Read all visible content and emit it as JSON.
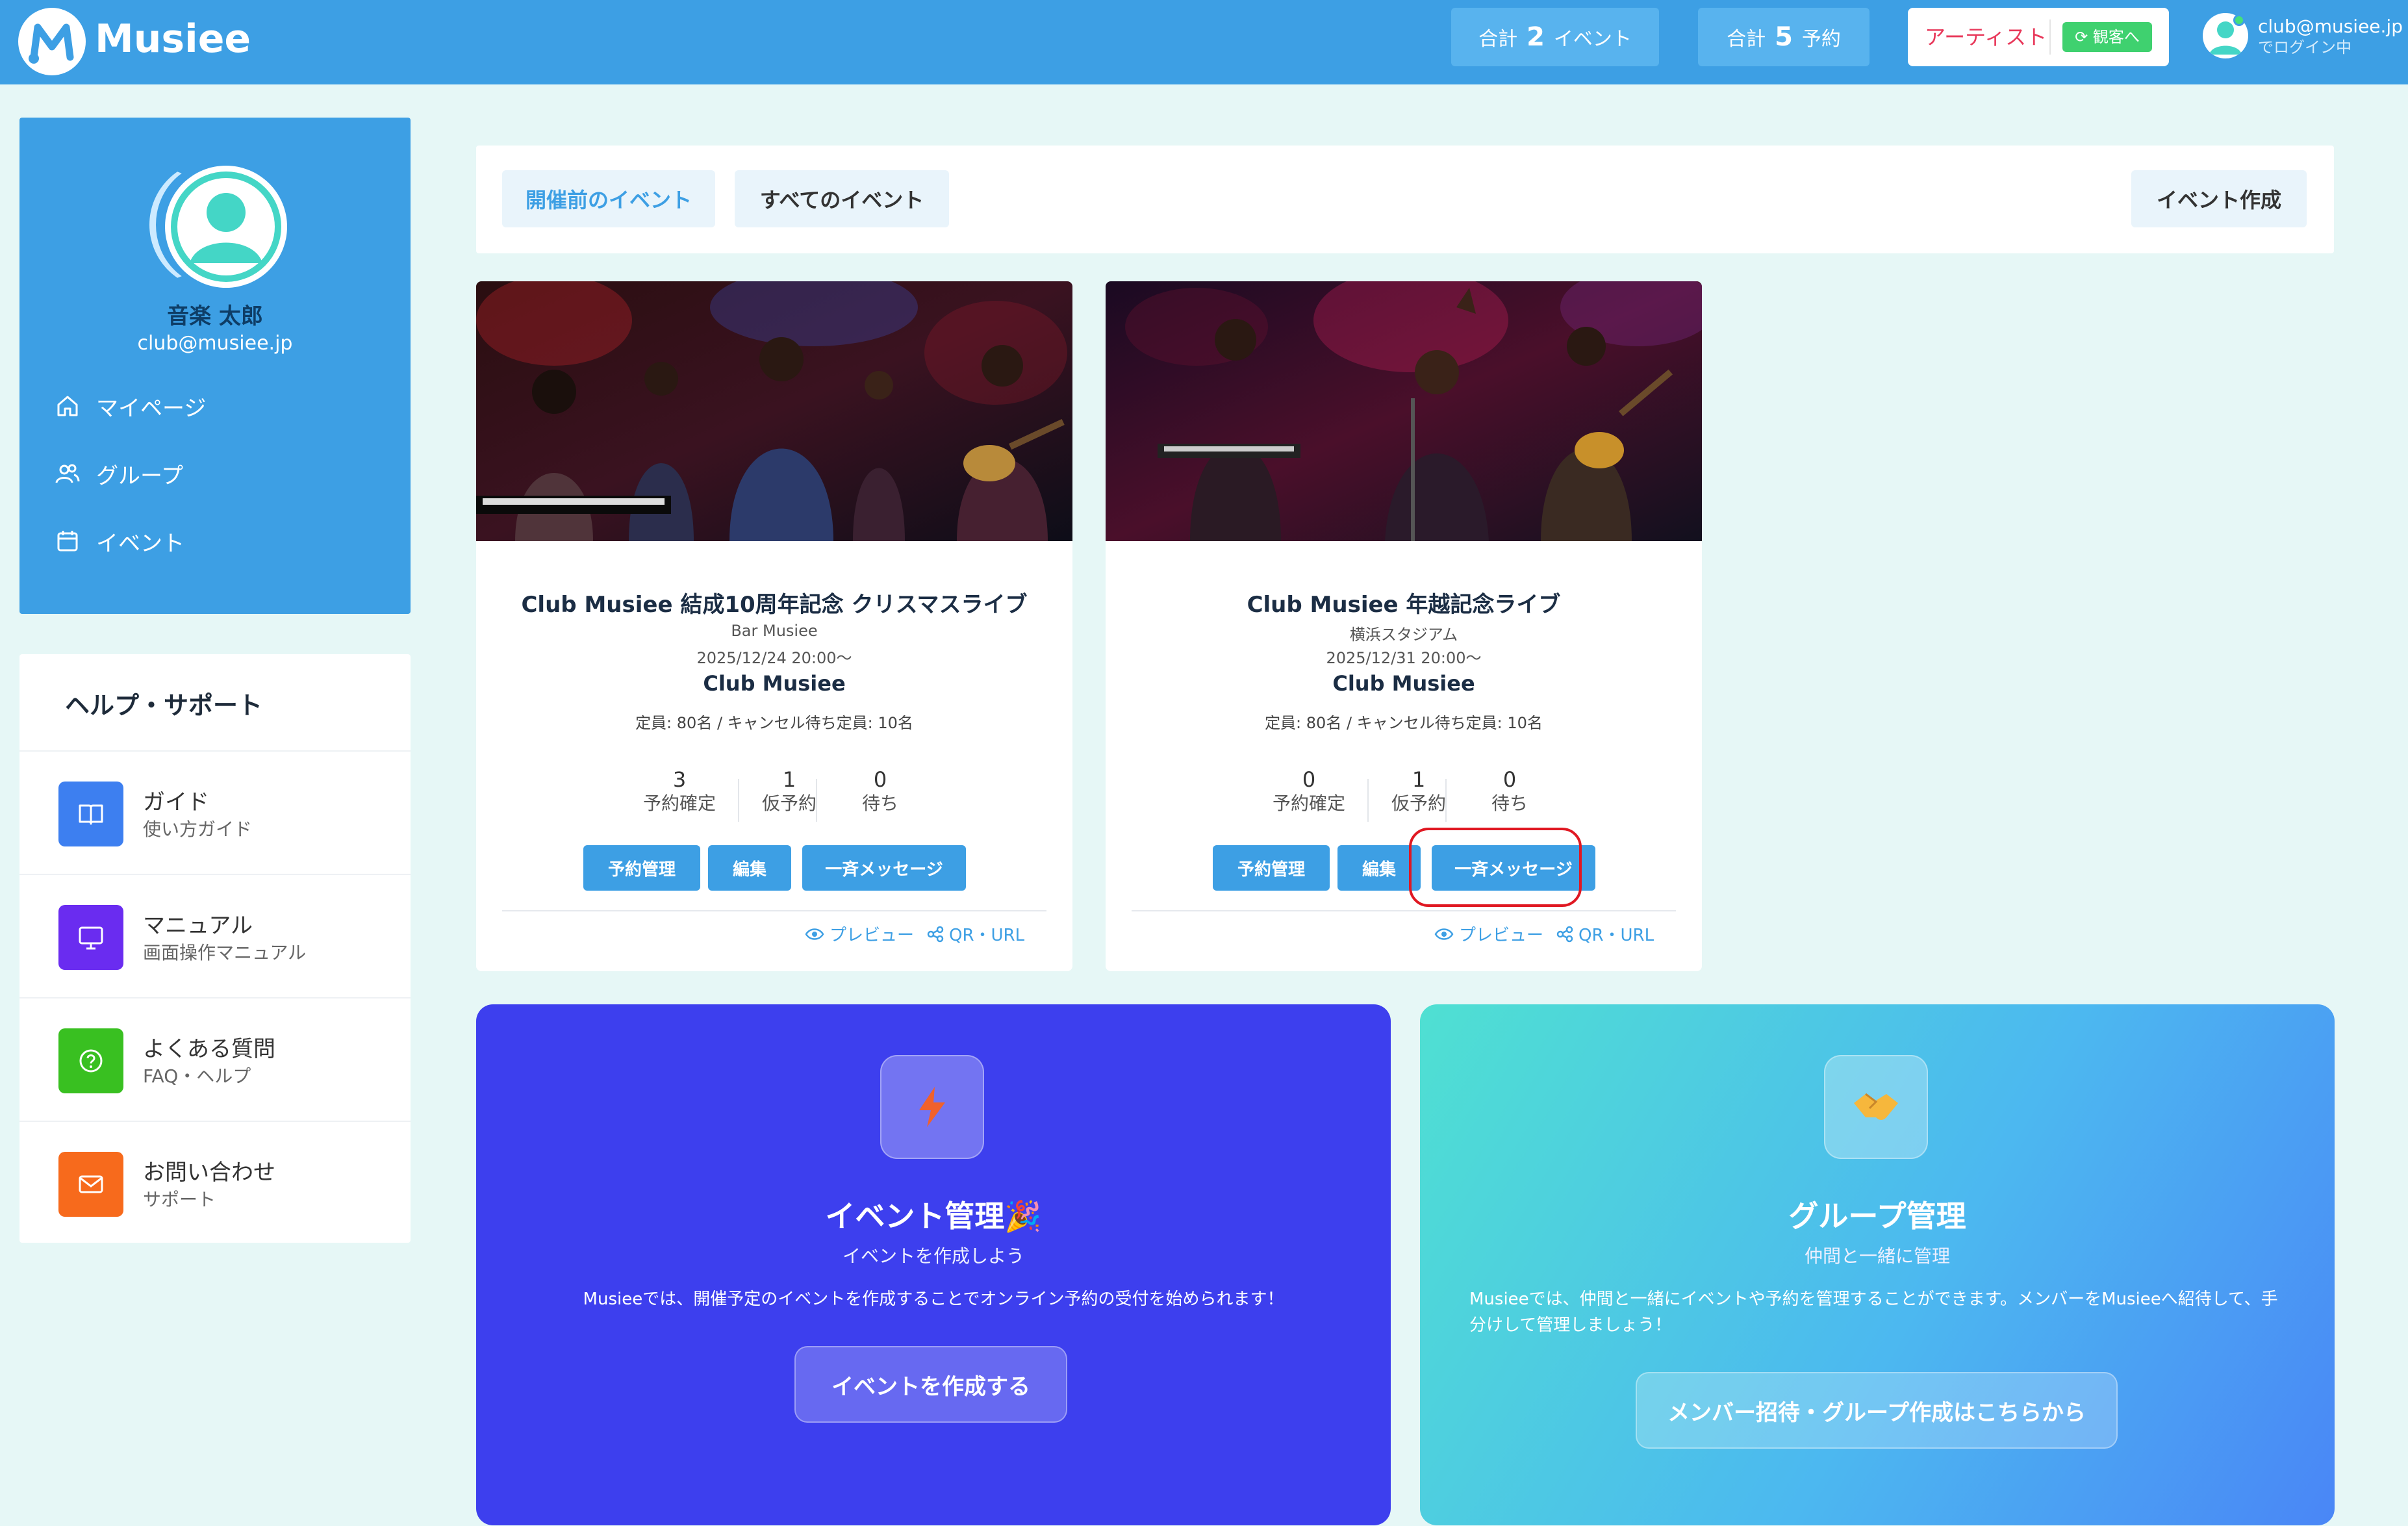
{
  "header": {
    "logo_text": "Musiee",
    "event_total": {
      "prefix": "合計",
      "count": "2",
      "suffix": "イベント"
    },
    "reservation_total": {
      "prefix": "合計",
      "count": "5",
      "suffix": "予約"
    },
    "role_label": "アーティスト",
    "switch_label": "観客へ",
    "user_email": "club@musiee.jp",
    "user_status": "でログイン中"
  },
  "sidebar": {
    "profile_name": "音楽 太郎",
    "profile_email": "club@musiee.jp",
    "nav": [
      {
        "label": "マイページ",
        "icon": "home-icon"
      },
      {
        "label": "グループ",
        "icon": "users-icon"
      },
      {
        "label": "イベント",
        "icon": "calendar-icon"
      }
    ],
    "help": {
      "title": "ヘルプ・サポート",
      "items": [
        {
          "name": "ガイド",
          "sub": "使い方ガイド",
          "icon": "book-icon",
          "color": "#3d7ff0"
        },
        {
          "name": "マニュアル",
          "sub": "画面操作マニュアル",
          "icon": "monitor-icon",
          "color": "#6a2cf0"
        },
        {
          "name": "よくある質問",
          "sub": "FAQ・ヘルプ",
          "icon": "question-icon",
          "color": "#39c021"
        },
        {
          "name": "お問い合わせ",
          "sub": "サポート",
          "icon": "mail-icon",
          "color": "#f76a1c"
        }
      ]
    }
  },
  "filters": {
    "upcoming": "開催前のイベント",
    "all": "すべてのイベント",
    "create": "イベント作成"
  },
  "events": [
    {
      "title": "Club Musiee 結成10周年記念 クリスマスライブ",
      "venue": "Bar Musiee",
      "date": "2025/12/24 20:00〜",
      "organizer": "Club Musiee",
      "capacity": "定員: 80名 / キャンセル待ち定員: 10名",
      "stats": [
        {
          "value": "3",
          "label": "予約確定"
        },
        {
          "value": "1",
          "label": "仮予約"
        },
        {
          "value": "0",
          "label": "待ち"
        }
      ],
      "buttons": {
        "manage": "予約管理",
        "edit": "編集",
        "message": "一斉メッセージ"
      },
      "links": {
        "preview": "プレビュー",
        "qr": "QR・URL"
      }
    },
    {
      "title": "Club Musiee 年越記念ライブ",
      "venue": "横浜スタジアム",
      "date": "2025/12/31 20:00〜",
      "organizer": "Club Musiee",
      "capacity": "定員: 80名 / キャンセル待ち定員: 10名",
      "stats": [
        {
          "value": "0",
          "label": "予約確定"
        },
        {
          "value": "1",
          "label": "仮予約"
        },
        {
          "value": "0",
          "label": "待ち"
        }
      ],
      "buttons": {
        "manage": "予約管理",
        "edit": "編集",
        "message": "一斉メッセージ"
      },
      "links": {
        "preview": "プレビュー",
        "qr": "QR・URL"
      }
    }
  ],
  "promos": {
    "event": {
      "title": "イベント管理🎉",
      "subtitle": "イベントを作成しよう",
      "text": "Musieeでは、開催予定のイベントを作成することでオンライン予約の受付を始められます！",
      "button": "イベントを作成する",
      "icon": "lightning-icon"
    },
    "group": {
      "title": "グループ管理",
      "subtitle": "仲間と一緒に管理",
      "text": "Musieeでは、仲間と一緒にイベントや予約を管理することができます。メンバーをMusieeへ紹待して、手分けして管理しましょう！",
      "button": "メンバー招待・グループ作成はこちらから",
      "icon": "handshake-icon"
    }
  },
  "colors": {
    "primary": "#3d9fe4",
    "highlight": "#e01822",
    "promo_event_bg": "#3d3fee"
  }
}
